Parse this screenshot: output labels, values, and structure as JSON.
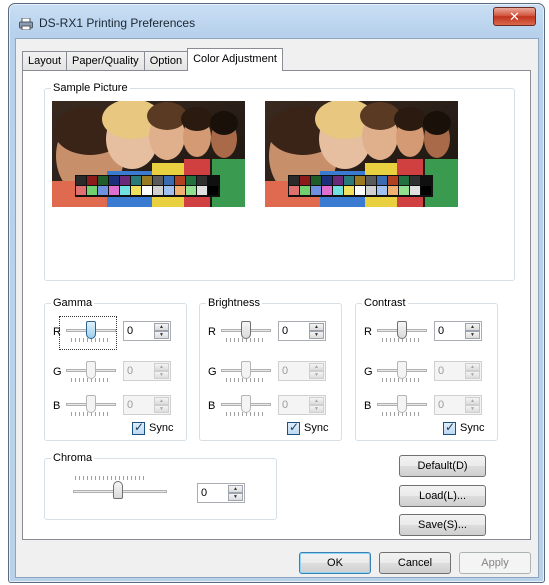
{
  "window": {
    "title": "DS-RX1 Printing Preferences",
    "close_glyph": "✕"
  },
  "tabs": [
    {
      "label": "Layout"
    },
    {
      "label": "Paper/Quality"
    },
    {
      "label": "Option"
    },
    {
      "label": "Color Adjustment",
      "active": true
    }
  ],
  "sample_picture": {
    "label": "Sample Picture"
  },
  "gamma": {
    "label": "Gamma",
    "channels": [
      {
        "name": "R",
        "value": "0",
        "enabled": true
      },
      {
        "name": "G",
        "value": "0",
        "enabled": false
      },
      {
        "name": "B",
        "value": "0",
        "enabled": false
      }
    ],
    "sync_label": "Sync",
    "sync_checked": true
  },
  "brightness": {
    "label": "Brightness",
    "channels": [
      {
        "name": "R",
        "value": "0",
        "enabled": true
      },
      {
        "name": "G",
        "value": "0",
        "enabled": false
      },
      {
        "name": "B",
        "value": "0",
        "enabled": false
      }
    ],
    "sync_label": "Sync",
    "sync_checked": true
  },
  "contrast": {
    "label": "Contrast",
    "channels": [
      {
        "name": "R",
        "value": "0",
        "enabled": true
      },
      {
        "name": "G",
        "value": "0",
        "enabled": false
      },
      {
        "name": "B",
        "value": "0",
        "enabled": false
      }
    ],
    "sync_label": "Sync",
    "sync_checked": true
  },
  "chroma": {
    "label": "Chroma",
    "value": "0"
  },
  "side_buttons": {
    "default_label": "Default(D)",
    "load_label": "Load(L)...",
    "save_label": "Save(S)..."
  },
  "footer": {
    "ok_label": "OK",
    "cancel_label": "Cancel",
    "apply_label": "Apply"
  },
  "swatch_colors": [
    "#2a2a2a",
    "#8b1a1a",
    "#1f5c2a",
    "#1d2e7a",
    "#6a2a7a",
    "#2a7a7a",
    "#9a7a20",
    "#5a5a5a",
    "#3a6ab0",
    "#b04020",
    "#207040",
    "#303030",
    "#101010",
    "#e07070",
    "#70d070",
    "#7090e0",
    "#e070d0",
    "#70e0e0",
    "#f0e060",
    "#ffffff",
    "#d0d0d0",
    "#a0c0f0",
    "#f0b070",
    "#90e090",
    "#e0e0e0",
    "#000000"
  ]
}
